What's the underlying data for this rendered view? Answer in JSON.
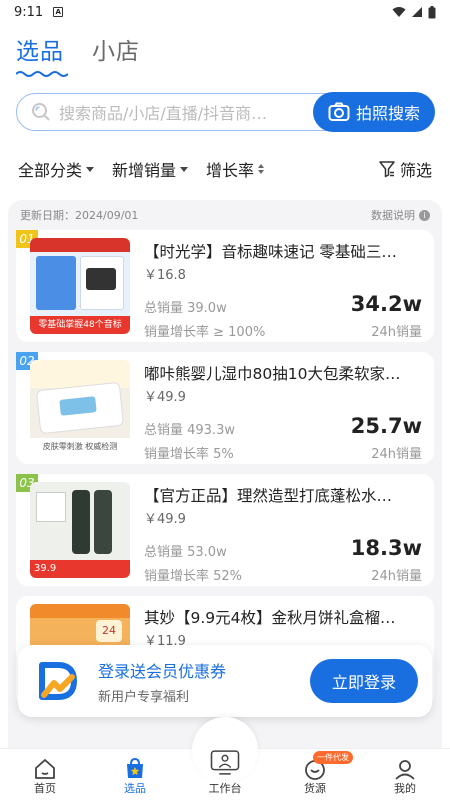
{
  "status": {
    "time": "9:11",
    "notification": "A"
  },
  "tabs": [
    {
      "label": "选品",
      "active": true
    },
    {
      "label": "小店",
      "active": false
    }
  ],
  "search": {
    "placeholder": "搜索商品/小店/直播/抖音商…",
    "photo_button": "拍照搜索"
  },
  "filters": {
    "category": "全部分类",
    "new_sales": "新增销量",
    "growth": "增长率",
    "filter": "筛选"
  },
  "meta": {
    "update_date": "更新日期：2024/09/01",
    "data_note": "数据说明"
  },
  "products": [
    {
      "rank": "01",
      "rank_color": "#f0c419",
      "title": "【时光学】音标趣味速记 零基础三…",
      "price": "￥16.8",
      "total_sales_label": "总销量 39.0w",
      "growth_label": "销量增长率 ≥ 100%",
      "sales_24h": "34.2w",
      "sales_24h_label": "24h销量",
      "thumb_caption": "零基础掌握48个音标"
    },
    {
      "rank": "02",
      "rank_color": "#4aa3f0",
      "title": "嘟咔熊婴儿湿巾80抽10大包柔软家…",
      "price": "￥49.9",
      "total_sales_label": "总销量 493.3w",
      "growth_label": "销量增长率 5%",
      "sales_24h": "25.7w",
      "sales_24h_label": "24h销量",
      "thumb_caption": "皮肤零刺激   权威检测"
    },
    {
      "rank": "03",
      "rank_color": "#8bc34a",
      "title": "【官方正品】理然造型打底蓬松水…",
      "price": "￥49.9",
      "total_sales_label": "总销量 53.0w",
      "growth_label": "销量增长率 52%",
      "sales_24h": "18.3w",
      "sales_24h_label": "24h销量",
      "thumb_caption": "39.9"
    },
    {
      "rank": "",
      "rank_color": "#ffffff",
      "title": "其妙【9.9元4枚】金秋月饼礼盒榴…",
      "price": "￥11.9",
      "total_sales_label": "",
      "growth_label": "",
      "sales_24h": "",
      "sales_24h_label": "",
      "thumb_caption": "24"
    }
  ],
  "login_banner": {
    "title": "登录送会员优惠券",
    "subtitle": "新用户专享福利",
    "button": "立即登录"
  },
  "nav": [
    {
      "label": "首页",
      "icon": "home-icon",
      "active": false
    },
    {
      "label": "选品",
      "icon": "bag-icon",
      "active": true
    },
    {
      "label": "工作台",
      "icon": "monitor-icon",
      "active": false
    },
    {
      "label": "货源",
      "icon": "supply-icon",
      "active": false,
      "badge": "一件代发"
    },
    {
      "label": "我的",
      "icon": "profile-icon",
      "active": false
    }
  ],
  "colors": {
    "primary": "#1a6fe0"
  }
}
